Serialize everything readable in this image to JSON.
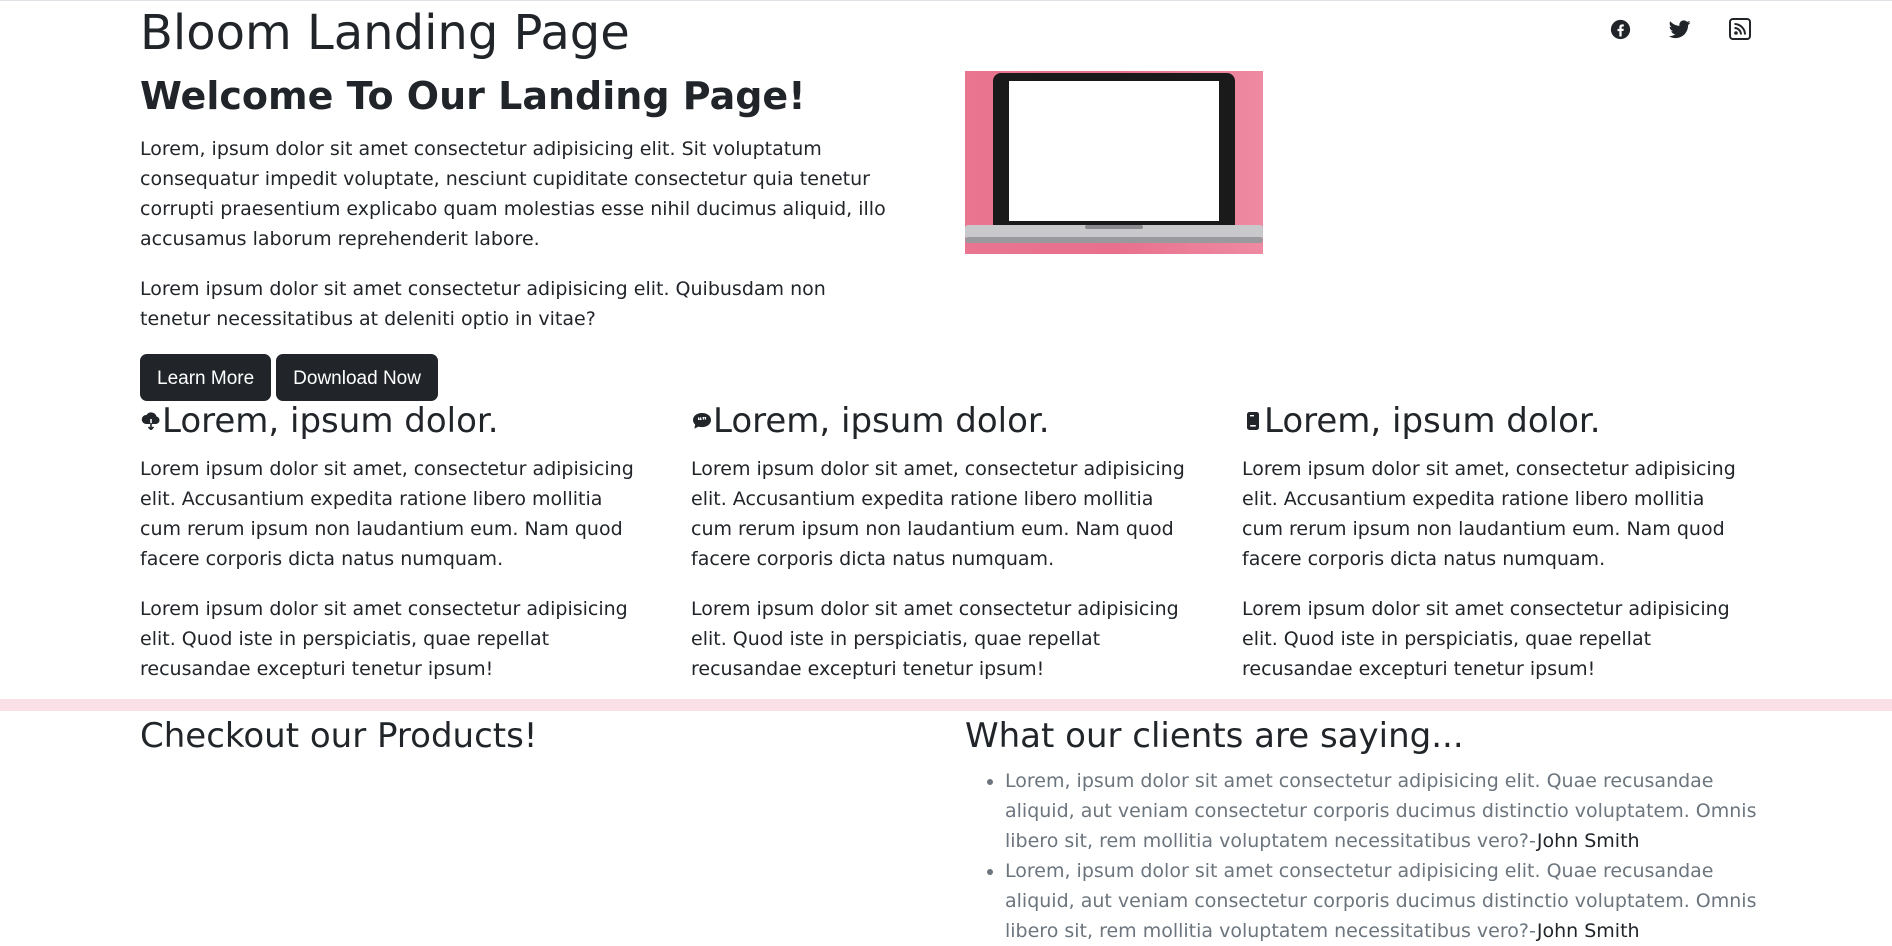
{
  "header": {
    "title": "Bloom Landing Page",
    "social_icons": [
      "facebook-icon",
      "twitter-icon",
      "rss-icon"
    ]
  },
  "hero": {
    "heading": "Welcome To Our Landing Page!",
    "paragraph1": "Lorem, ipsum dolor sit amet consectetur adipisicing elit. Sit voluptatum consequatur impedit voluptate, nesciunt cupiditate consectetur quia tenetur corrupti praesentium explicabo quam molestias esse nihil ducimus aliquid, illo accusamus laborum reprehenderit labore.",
    "paragraph2": "Lorem ipsum dolor sit amet consectetur adipisicing elit. Quibusdam non tenetur necessitatibus at deleniti optio in vitae?",
    "learn_more_label": "Learn More",
    "download_label": "Download Now",
    "image_bg_color": "#e8708d"
  },
  "features": [
    {
      "icon": "cloud-download-icon",
      "heading": "Lorem, ipsum dolor.",
      "p1": "Lorem ipsum dolor sit amet, consectetur adipisicing elit. Accusantium expedita ratione libero mollitia cum rerum ipsum non laudantium eum. Nam quod facere corporis dicta natus numquam.",
      "p2": "Lorem ipsum dolor sit amet consectetur adipisicing elit. Quod iste in perspiciatis, quae repellat recusandae excepturi tenetur ipsum!"
    },
    {
      "icon": "chat-quote-icon",
      "heading": "Lorem, ipsum dolor.",
      "p1": "Lorem ipsum dolor sit amet, consectetur adipisicing elit. Accusantium expedita ratione libero mollitia cum rerum ipsum non laudantium eum. Nam quod facere corporis dicta natus numquam.",
      "p2": "Lorem ipsum dolor sit amet consectetur adipisicing elit. Quod iste in perspiciatis, quae repellat recusandae excepturi tenetur ipsum!"
    },
    {
      "icon": "phone-icon",
      "heading": "Lorem, ipsum dolor.",
      "p1": "Lorem ipsum dolor sit amet, consectetur adipisicing elit. Accusantium expedita ratione libero mollitia cum rerum ipsum non laudantium eum. Nam quod facere corporis dicta natus numquam.",
      "p2": "Lorem ipsum dolor sit amet consectetur adipisicing elit. Quod iste in perspiciatis, quae repellat recusandae excepturi tenetur ipsum!"
    }
  ],
  "section_band_color": "#fbe1e7",
  "products": {
    "heading": "Checkout our Products!"
  },
  "testimonials": {
    "heading": "What our clients are saying...",
    "items": [
      {
        "quote": "Lorem, ipsum dolor sit amet consectetur adipisicing elit. Quae recusandae aliquid, aut veniam consectetur corporis ducimus distinctio voluptatem. Omnis libero sit, rem mollitia voluptatem necessitatibus vero?-",
        "author": "John Smith"
      },
      {
        "quote": "Lorem, ipsum dolor sit amet consectetur adipisicing elit. Quae recusandae aliquid, aut veniam consectetur corporis ducimus distinctio voluptatem. Omnis libero sit, rem mollitia voluptatem necessitatibus vero?-",
        "author": "John Smith"
      }
    ]
  }
}
